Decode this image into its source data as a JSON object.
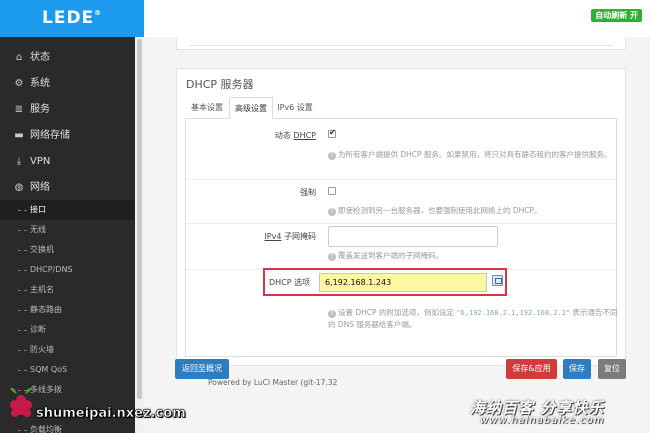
{
  "brand": {
    "name": "LEDE",
    "mark": "®"
  },
  "header": {
    "auto_refresh": "自动刷新 开"
  },
  "sidebar": {
    "top_items": [
      {
        "label": "状态",
        "icon": "home-icon"
      },
      {
        "label": "系统",
        "icon": "gear-icon"
      },
      {
        "label": "服务",
        "icon": "list-icon"
      },
      {
        "label": "网络存储",
        "icon": "drive-icon"
      },
      {
        "label": "VPN",
        "icon": "download-icon"
      },
      {
        "label": "网络",
        "icon": "globe-icon"
      }
    ],
    "sub_items": [
      "接口",
      "无线",
      "交换机",
      "DHCP/DNS",
      "主机名",
      "静态路由",
      "诊断",
      "防火墙",
      "SQM QoS",
      "多线多拨",
      "负载均衡"
    ]
  },
  "card": {
    "title": "DHCP 服务器",
    "tabs": [
      "基本设置",
      "高级设置",
      "IPv6 设置"
    ],
    "active_tab": 1,
    "rows": {
      "dynamic_dhcp": {
        "label_prefix": "动态",
        "label_abbr": "DHCP",
        "checked": true,
        "help": "为所有客户端提供 DHCP 服务。如果禁用，将只对具有静态租约的客户提供服务。"
      },
      "force": {
        "label": "强制",
        "checked": false,
        "help": "即使检测到另一台服务器，也要强制使用此网络上的 DHCP。"
      },
      "netmask": {
        "label_abbr": "IPv4",
        "label_suffix": "子网掩码",
        "value": "",
        "help": "覆盖发送到客户端的子网掩码。"
      },
      "dhcp_options": {
        "label": "DHCP 选项",
        "value": "6,192.168.1.243",
        "help_prefix": "设置 DHCP 的附加选项，例如设定",
        "help_code": "\"6,192.168.2.1,192.168.2.2\"",
        "help_suffix": "表示通告不同的 DNS 服务器给客户端。"
      }
    }
  },
  "buttons": {
    "back": "返回至概况",
    "save_apply": "保存&应用",
    "save": "保存",
    "reset": "复位"
  },
  "footer": {
    "text": "Powered by LuCI Master (git-17.32"
  },
  "watermarks": {
    "left": "shumeipai.nxez.com",
    "right_main": "海纳百客 分享快乐",
    "right_sub": "www.hainabaike.com"
  },
  "colors": {
    "brand_blue": "#1b9aee",
    "sidebar_bg": "#2a2a2a",
    "primary": "#2f7dc1",
    "danger": "#d03b3b",
    "success": "#2cb22c",
    "highlight": "#d9334a"
  }
}
